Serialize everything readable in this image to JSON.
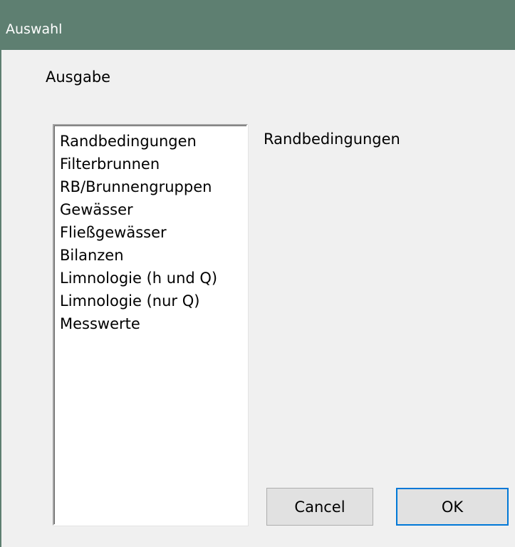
{
  "window": {
    "title": "Auswahl"
  },
  "group": {
    "label": "Ausgabe"
  },
  "list": {
    "items": [
      "Randbedingungen",
      "Filterbrunnen",
      "RB/Brunnengruppen",
      "Gewässer",
      "Fließgewässer",
      "Bilanzen",
      "Limnologie (h und Q)",
      "Limnologie (nur Q)",
      "Messwerte"
    ]
  },
  "selection": {
    "value": "Randbedingungen"
  },
  "buttons": {
    "cancel_label": "Cancel",
    "ok_label": "OK"
  },
  "colors": {
    "titlebar": "#5e7f71",
    "window_bg": "#f0f0f0",
    "button_bg": "#e1e1e1",
    "default_button_border": "#0078d7"
  }
}
